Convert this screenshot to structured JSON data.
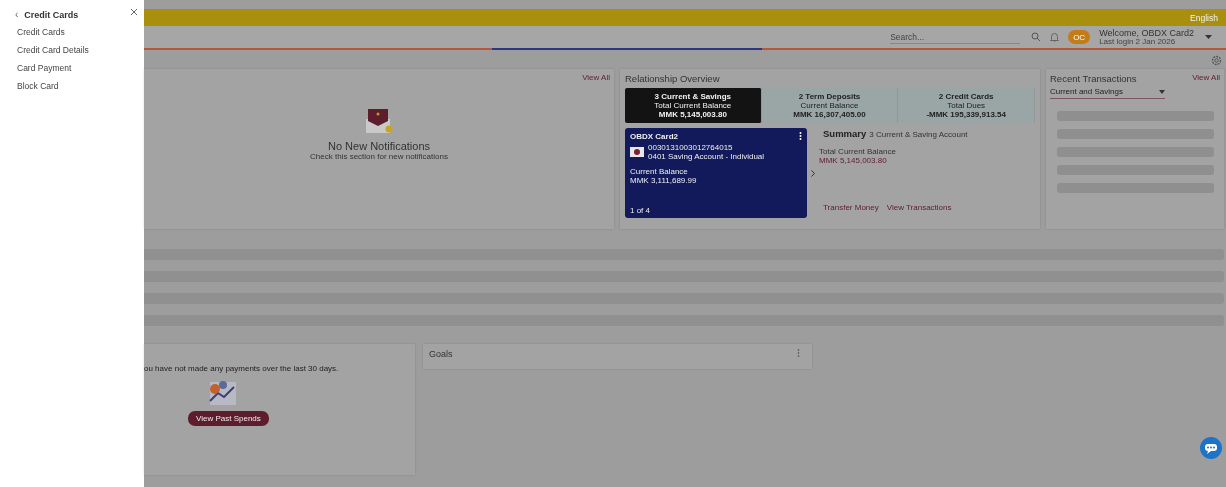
{
  "sidebar": {
    "back": "‹",
    "title": "Credit Cards",
    "items": [
      {
        "label": "Credit Cards"
      },
      {
        "label": "Credit Card Details"
      },
      {
        "label": "Card Payment"
      },
      {
        "label": "Block Card"
      }
    ]
  },
  "topbar": {
    "language": "English"
  },
  "header": {
    "search": {
      "placeholder": "Search..."
    },
    "avatar": "OC",
    "welcome": "Welcome, OBDX Card2",
    "last_login": "Last login 2 Jan 2026"
  },
  "notifications": {
    "view_all": "View All",
    "title": "No New Notifications",
    "subtitle": "Check this section for new notifications"
  },
  "relationship": {
    "title": "Relationship Overview",
    "tabs": [
      {
        "title": "3 Current & Savings",
        "label": "Total Current Balance",
        "amount": "MMK 5,145,003.80",
        "selected": true
      },
      {
        "title": "2 Term Deposits",
        "label": "Current Balance",
        "amount": "MMK 16,307,405.00",
        "selected": false
      },
      {
        "title": "2 Credit Cards",
        "label": "Total Dues",
        "amount": "-MMK 195,339,913.54",
        "selected": false
      }
    ],
    "account_card": {
      "name": "OBDX Card2",
      "number": "0030131003012764015",
      "type": "0401 Saving Account - Individual",
      "balance_label": "Current Balance",
      "balance": "MMK 3,111,689.99",
      "pager": "1 of 4"
    },
    "summary": {
      "title": "Summary",
      "subtitle": "3 Current & Saving Account",
      "total_label": "Total Current Balance",
      "total": "MMK 5,145,003.80"
    },
    "actions": [
      "Transfer Money",
      "View Transactions"
    ]
  },
  "recent_transactions": {
    "title": "Recent Transactions",
    "view_all": "View All",
    "filter": "Current and Savings"
  },
  "spends": {
    "message": "ou have not made any payments over the last 30 days.",
    "button": "View Past Spends"
  },
  "goals": {
    "title": "Goals"
  }
}
